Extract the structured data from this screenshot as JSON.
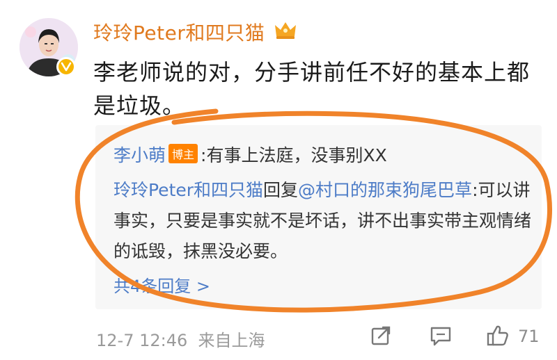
{
  "post": {
    "username": "玲玲Peter和四只猫",
    "text": "李老师说的对，分手讲前任不好的基本上都是垃圾。",
    "time": "12-7 12:46",
    "source": "来自上海"
  },
  "comment": {
    "author": "李小萌",
    "badge": "博主",
    "text": ":有事上法庭，没事别XX",
    "reply_author": "玲玲Peter和四只猫",
    "reply_word": "回复",
    "reply_target": "@村口的那束狗尾巴草",
    "reply_text": ":可以讲事实，只要是事实就不是坏话，讲不出事实带主观情绪的诋毁，抹黑没必要。",
    "more_link": "共4条回复 >"
  },
  "actions": {
    "share_icon": "share-icon",
    "comment_icon": "comment-icon",
    "like_icon": "thumbs-up-icon",
    "like_count": "71"
  },
  "colors": {
    "username": "#e07a1f",
    "link": "#4d7cc7",
    "badge": "#ff8200",
    "annotation": "#f0832a",
    "verified": "#f7b500"
  }
}
